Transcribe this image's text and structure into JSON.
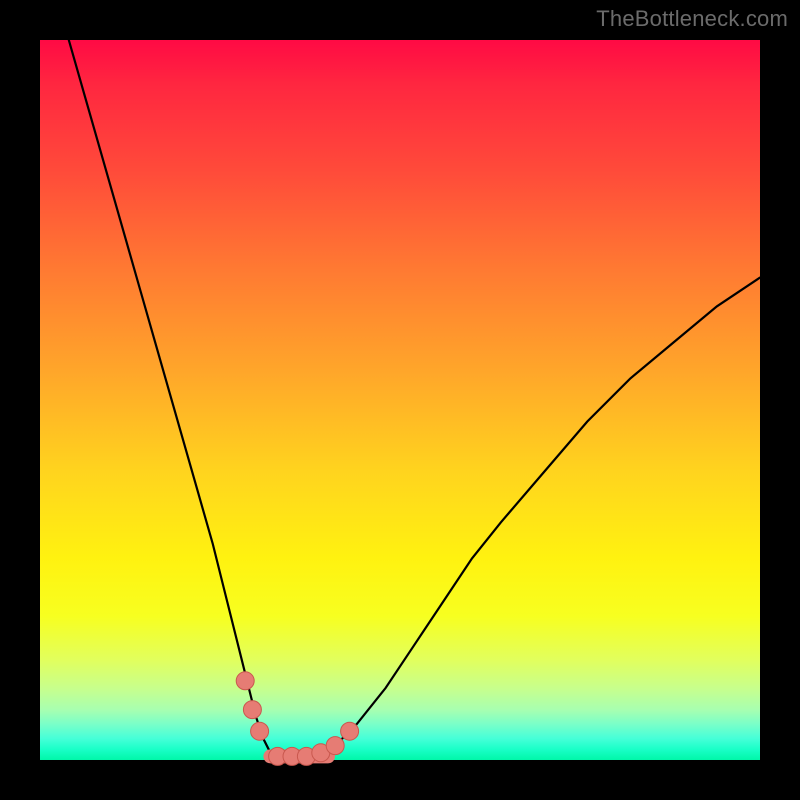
{
  "watermark": "TheBottleneck.com",
  "colors": {
    "frame": "#000000",
    "curve": "#000000",
    "marker_fill": "#e67c74",
    "marker_stroke": "#c9584e",
    "gradient_top": "#ff0a44",
    "gradient_bottom": "#00f7a8"
  },
  "chart_data": {
    "type": "line",
    "title": "",
    "xlabel": "",
    "ylabel": "",
    "xlim": [
      0,
      100
    ],
    "ylim": [
      0,
      100
    ],
    "grid": false,
    "legend": false,
    "series": [
      {
        "name": "curve",
        "x": [
          4,
          6,
          8,
          10,
          12,
          14,
          16,
          18,
          20,
          22,
          24,
          26,
          28,
          29,
          30,
          31,
          32,
          33,
          34,
          35,
          36,
          38,
          40,
          44,
          48,
          52,
          56,
          60,
          64,
          70,
          76,
          82,
          88,
          94,
          100
        ],
        "y": [
          100,
          93,
          86,
          79,
          72,
          65,
          58,
          51,
          44,
          37,
          30,
          22,
          14,
          10,
          6,
          3,
          1,
          0,
          0,
          0,
          0,
          0,
          1,
          5,
          10,
          16,
          22,
          28,
          33,
          40,
          47,
          53,
          58,
          63,
          67
        ]
      }
    ],
    "markers": [
      {
        "x": 28.5,
        "y": 11
      },
      {
        "x": 29.5,
        "y": 7
      },
      {
        "x": 30.5,
        "y": 4
      },
      {
        "x": 33.0,
        "y": 0.5
      },
      {
        "x": 35.0,
        "y": 0.5
      },
      {
        "x": 37.0,
        "y": 0.5
      },
      {
        "x": 39.0,
        "y": 1
      },
      {
        "x": 41.0,
        "y": 2
      },
      {
        "x": 43.0,
        "y": 4
      }
    ],
    "flat_segment": {
      "x0": 32,
      "x1": 40,
      "y": 0.5
    }
  }
}
